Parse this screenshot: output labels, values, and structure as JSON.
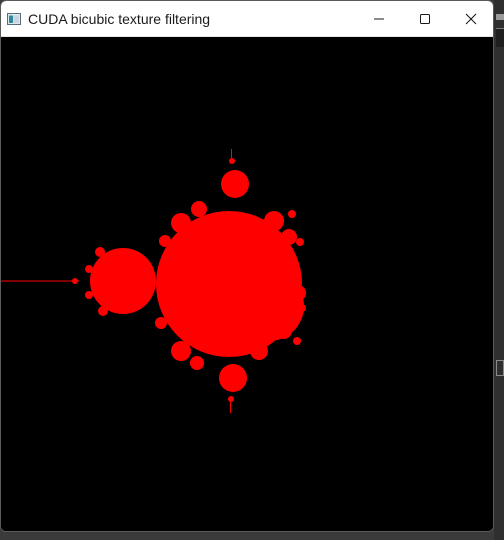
{
  "window": {
    "title": "CUDA bicubic texture filtering",
    "icon": "app-window-icon",
    "controls": {
      "minimize_icon": "minimize-icon",
      "maximize_icon": "maximize-icon",
      "close_icon": "close-icon"
    }
  },
  "render": {
    "subject": "Mandelbrot set",
    "background_color": "#000000",
    "fractal_color": "#ff0000"
  },
  "colors": {
    "titlebar": "#ffffff",
    "title_text": "#1a1a1a"
  }
}
